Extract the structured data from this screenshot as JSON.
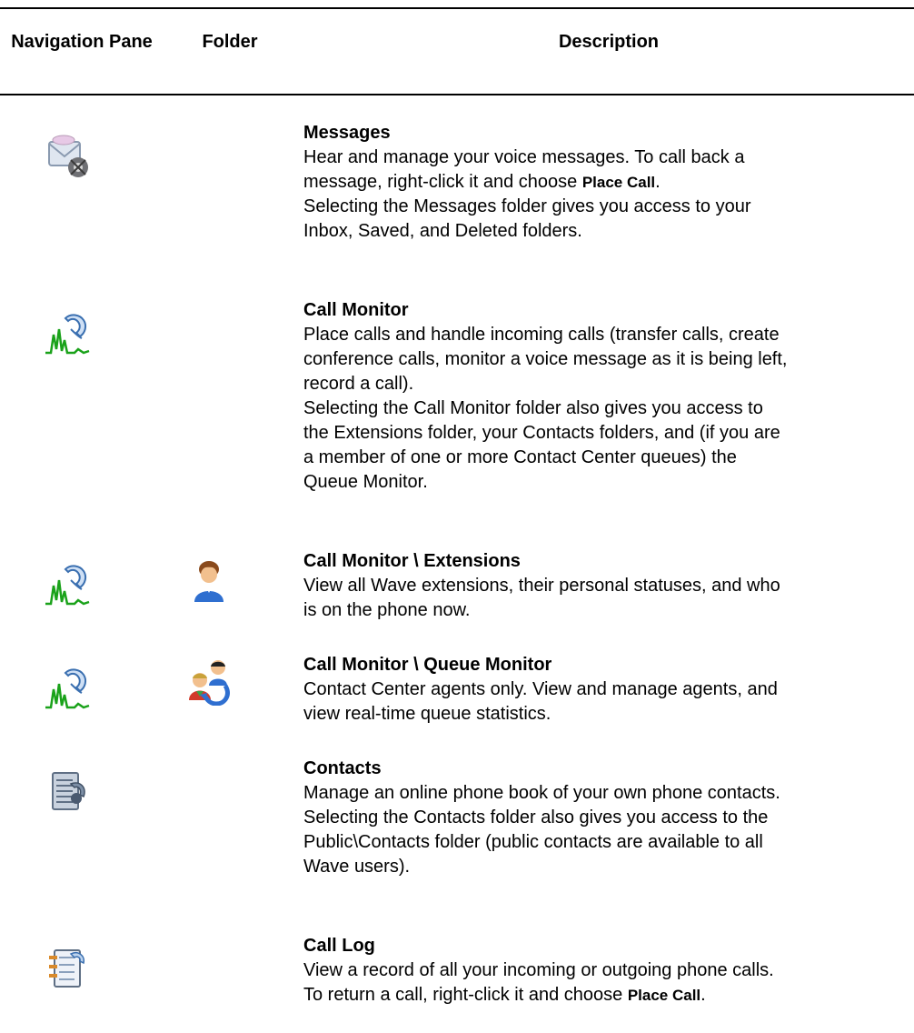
{
  "table": {
    "headers": {
      "navigation_pane": "Navigation Pane",
      "folder": "Folder",
      "description": "Description"
    },
    "rows": [
      {
        "nav_icon": "messages-icon",
        "folder_icon": "",
        "title": "Messages",
        "lines": [
          {
            "a": "Hear and manage your voice messages. To call back a",
            "cmd": "",
            "b": ""
          },
          {
            "a": "message, right-click it and choose ",
            "cmd": "Place Call",
            "b": "."
          },
          {
            "a": "Selecting the Messages folder gives you access to your",
            "cmd": "",
            "b": ""
          },
          {
            "a": "Inbox, Saved, and Deleted folders.",
            "cmd": "",
            "b": ""
          }
        ]
      },
      {
        "nav_icon": "call-monitor-icon",
        "folder_icon": "",
        "title": "Call Monitor",
        "lines": [
          {
            "a": "Place calls and handle incoming calls (transfer calls, create",
            "cmd": "",
            "b": ""
          },
          {
            "a": "conference calls, monitor a voice message as it is being left,",
            "cmd": "",
            "b": ""
          },
          {
            "a": "record a call).",
            "cmd": "",
            "b": ""
          },
          {
            "a": "Selecting the Call Monitor folder also gives you access to",
            "cmd": "",
            "b": ""
          },
          {
            "a": "the Extensions folder, your Contacts folders, and (if you are",
            "cmd": "",
            "b": ""
          },
          {
            "a": "a member of one or more Contact Center queues) the",
            "cmd": "",
            "b": ""
          },
          {
            "a": "Queue Monitor.",
            "cmd": "",
            "b": ""
          }
        ]
      },
      {
        "nav_icon": "call-monitor-icon",
        "folder_icon": "extensions-person-icon",
        "title": "Call Monitor \\ Extensions",
        "lines": [
          {
            "a": "View all Wave extensions, their personal statuses, and who",
            "cmd": "",
            "b": ""
          },
          {
            "a": "is on the phone now.",
            "cmd": "",
            "b": ""
          }
        ]
      },
      {
        "nav_icon": "call-monitor-icon",
        "folder_icon": "queue-monitor-agents-icon",
        "title": "Call Monitor \\ Queue Monitor",
        "lines": [
          {
            "a": "Contact Center agents only. View and manage agents, and",
            "cmd": "",
            "b": ""
          },
          {
            "a": "view real-time queue statistics.",
            "cmd": "",
            "b": ""
          }
        ]
      },
      {
        "nav_icon": "contacts-icon",
        "folder_icon": "",
        "title": "Contacts",
        "lines": [
          {
            "a": "Manage an online phone book of your own phone contacts.",
            "cmd": "",
            "b": ""
          },
          {
            "a": "Selecting the Contacts folder also gives you access to the",
            "cmd": "",
            "b": ""
          },
          {
            "a": "Public\\Contacts folder (public contacts are available to all",
            "cmd": "",
            "b": ""
          },
          {
            "a": "Wave users).",
            "cmd": "",
            "b": ""
          }
        ]
      },
      {
        "nav_icon": "call-log-icon",
        "folder_icon": "",
        "title": "Call Log",
        "lines": [
          {
            "a": "View a record of all your incoming or outgoing phone calls.",
            "cmd": "",
            "b": ""
          },
          {
            "a": "To return a call, right-click it and choose ",
            "cmd": "Place Call",
            "b": "."
          }
        ]
      }
    ]
  }
}
